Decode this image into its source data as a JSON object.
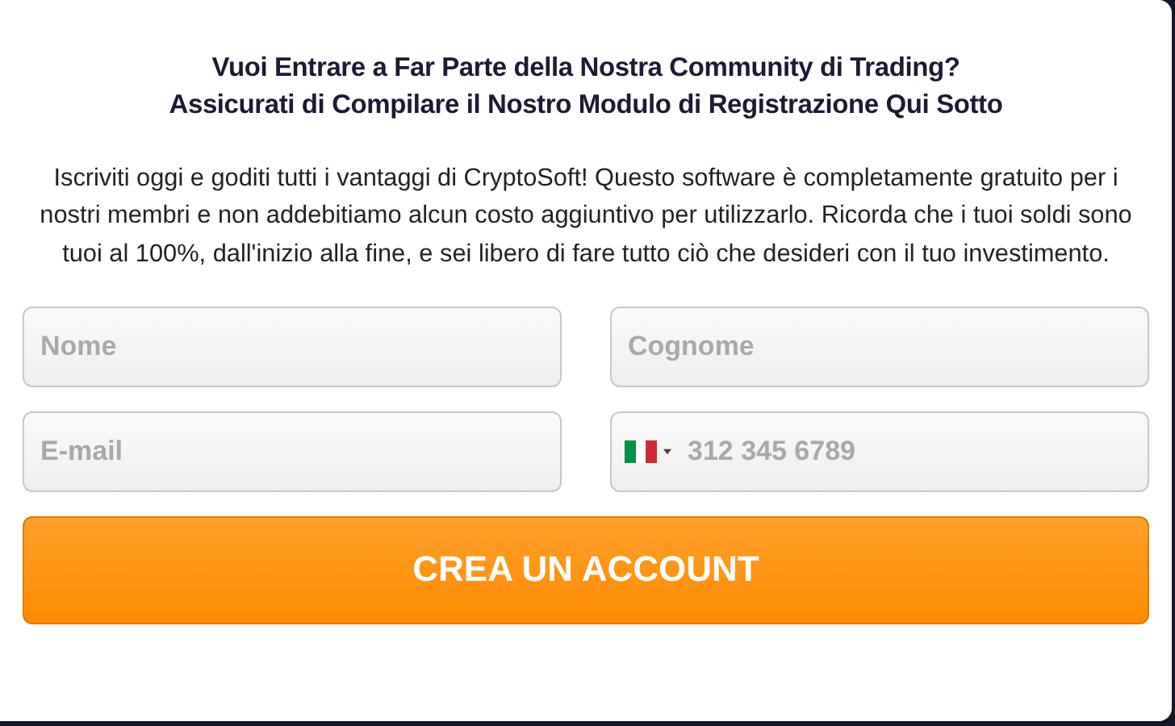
{
  "heading": [
    "Vuoi Entrare a Far Parte della Nostra Community di Trading?",
    "Assicurati di Compilare il Nostro Modulo di Registrazione Qui Sotto"
  ],
  "intro": "Iscriviti oggi e goditi tutti i vantaggi di CryptoSoft! Questo software è completamente gratuito per i nostri membri e non addebitiamo alcun costo aggiuntivo per utilizzarlo. Ricorda che i tuoi soldi sono tuoi al 100%, dall'inizio alla fine, e sei libero di fare tutto ciò che desideri con il tuo investimento.",
  "fields": [
    {
      "kind": "text",
      "placeholder": "Nome"
    },
    {
      "kind": "text",
      "placeholder": "Cognome"
    },
    {
      "kind": "email",
      "placeholder": "E-mail"
    },
    {
      "kind": "phone",
      "placeholder": "312 345 6789"
    }
  ],
  "submit": {
    "label": "CREA UN ACCOUNT"
  }
}
